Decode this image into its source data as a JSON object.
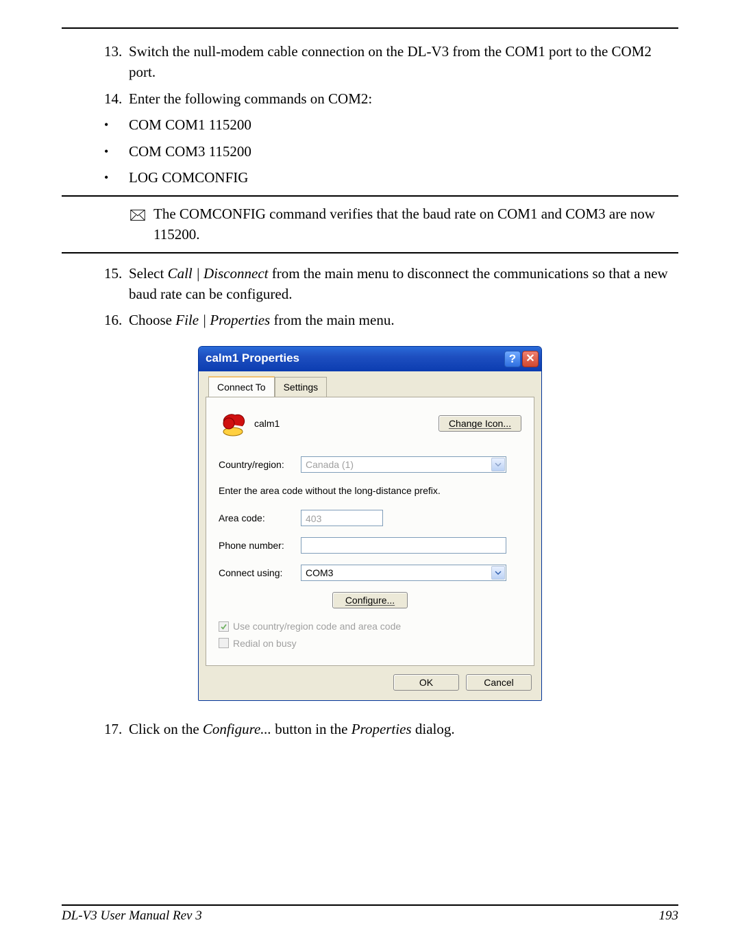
{
  "steps": {
    "s13_num": "13.",
    "s13": "Switch the null-modem cable connection on the DL-V3 from the COM1 port to the COM2 port.",
    "s14_num": "14.",
    "s14": "Enter the following commands on COM2:",
    "b1": "COM COM1 115200",
    "b2": "COM COM3 115200",
    "b3": "LOG COMCONFIG",
    "note": "The COMCONFIG command verifies that the baud rate on COM1 and COM3 are now 115200.",
    "s15_num": "15.",
    "s15_pre": "Select ",
    "s15_em": "Call | Disconnect",
    "s15_post": " from the main menu to disconnect the communications so that a new baud rate can be configured.",
    "s16_num": "16.",
    "s16_pre": "Choose ",
    "s16_em": "File | Properties",
    "s16_post": " from the main menu.",
    "s17_num": "17.",
    "s17_pre": "Click on the ",
    "s17_em1": "Configure...",
    "s17_mid": " button in the ",
    "s17_em2": "Properties",
    "s17_post": " dialog."
  },
  "dialog": {
    "title": "calm1 Properties",
    "tab_connect": "Connect To",
    "tab_settings": "Settings",
    "conn_name": "calm1",
    "change_icon": "Change Icon...",
    "country_label": "Country/region:",
    "country_value": "Canada (1)",
    "area_helper": "Enter the area code without the long-distance prefix.",
    "area_label": "Area code:",
    "area_value": "403",
    "phone_label": "Phone number:",
    "phone_value": "",
    "using_label": "Connect using:",
    "using_value": "COM3",
    "configure": "Configure...",
    "chk1": "Use country/region code and area code",
    "chk2": "Redial on busy",
    "ok": "OK",
    "cancel": "Cancel"
  },
  "footer": {
    "left": "DL-V3 User Manual Rev 3",
    "right": "193"
  }
}
